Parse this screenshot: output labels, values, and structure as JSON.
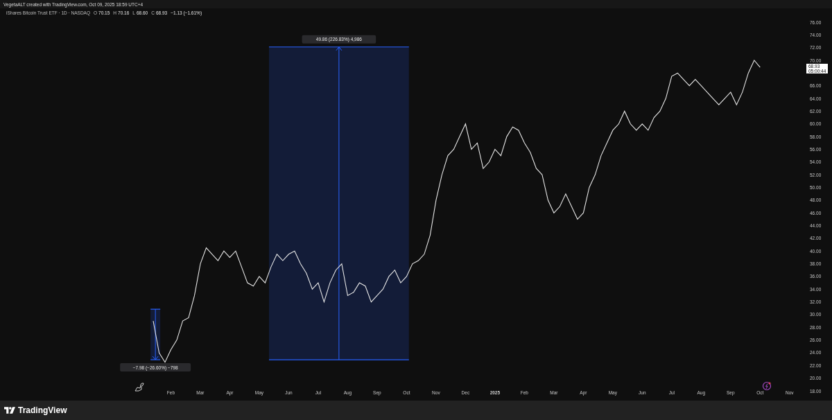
{
  "header": {
    "caption": "VegetaALT created with TradingView.com, Oct 09, 2025 18:59 UTC+4"
  },
  "legend": {
    "symbol": "iShares Bitcoin Trust ETF · 1D · NASDAQ",
    "ohlc": [
      {
        "label": "O",
        "value": "70.15"
      },
      {
        "label": "H",
        "value": "70.16"
      },
      {
        "label": "L",
        "value": "68.60"
      },
      {
        "label": "C",
        "value": "68.93"
      }
    ],
    "change": "−1.13 (−1.61%)"
  },
  "price_tag": {
    "value": "68.93",
    "countdown": "05:00:44"
  },
  "chart": {
    "chart_data": {
      "type": "line",
      "categories": [
        null,
        null,
        null,
        "Feb",
        null,
        null,
        null,
        null,
        "Mar",
        null,
        null,
        null,
        null,
        "Apr",
        null,
        null,
        null,
        null,
        "May",
        null,
        null,
        null,
        null,
        "Jun",
        null,
        null,
        null,
        null,
        "Jul",
        null,
        null,
        null,
        null,
        "Aug",
        null,
        null,
        null,
        null,
        "Sep",
        null,
        null,
        null,
        null,
        "Oct",
        null,
        null,
        null,
        null,
        "Nov",
        null,
        null,
        null,
        null,
        "Dec",
        null,
        null,
        null,
        null,
        "2025",
        null,
        null,
        null,
        null,
        "Feb",
        null,
        null,
        null,
        null,
        "Mar",
        null,
        null,
        null,
        null,
        "Apr",
        null,
        null,
        null,
        null,
        "May",
        null,
        null,
        null,
        null,
        "Jun",
        null,
        null,
        null,
        null,
        "Jul",
        null,
        null,
        null,
        null,
        "Aug",
        null,
        null,
        null,
        null,
        "Sep",
        null,
        null,
        null,
        null,
        "Oct",
        null,
        null,
        null,
        null,
        "Nov"
      ],
      "series": [
        {
          "color": "#e6e6e6",
          "values": [
            29,
            24,
            22.5,
            24.5,
            26,
            29,
            29.5,
            33,
            38,
            40.5,
            39.5,
            38.5,
            40,
            39,
            40,
            37.5,
            35,
            34.5,
            36,
            35,
            37.5,
            39.5,
            38.5,
            39.5,
            40,
            38,
            36.5,
            34,
            35,
            32,
            35,
            37,
            38,
            33,
            33.5,
            35,
            34.5,
            32,
            33,
            34,
            36,
            37,
            35,
            36,
            38,
            38.5,
            39.5,
            42.5,
            48,
            52,
            55,
            56,
            58,
            60,
            56,
            57,
            53,
            54,
            56,
            55,
            58,
            59.5,
            59,
            57,
            55.5,
            53,
            52,
            48,
            46,
            47,
            49,
            47,
            45,
            46,
            50,
            52,
            55,
            57,
            59,
            60,
            62,
            60,
            59,
            60,
            59,
            61,
            62,
            64,
            67.5,
            68,
            67,
            66,
            67,
            66,
            65,
            64,
            63,
            64,
            65,
            63,
            65,
            68,
            70,
            68.9,
            null,
            null,
            null,
            null,
            null
          ]
        }
      ],
      "ylim": [
        18,
        76
      ],
      "yticks": [
        {
          "value": 76,
          "label": "76.00"
        },
        {
          "value": 74,
          "label": "74.00"
        },
        {
          "value": 72,
          "label": "72.00"
        },
        {
          "value": 70,
          "label": "70.00"
        },
        {
          "value": 66,
          "label": "66.00"
        },
        {
          "value": 64,
          "label": "64.00"
        },
        {
          "value": 62,
          "label": "62.00"
        },
        {
          "value": 60,
          "label": "60.00"
        },
        {
          "value": 58,
          "label": "58.00"
        },
        {
          "value": 56,
          "label": "56.00"
        },
        {
          "value": 54,
          "label": "54.00"
        },
        {
          "value": 52,
          "label": "52.00"
        },
        {
          "value": 50,
          "label": "50.00"
        },
        {
          "value": 48,
          "label": "48.00"
        },
        {
          "value": 46,
          "label": "46.00"
        },
        {
          "value": 44,
          "label": "44.00"
        },
        {
          "value": 42,
          "label": "42.00"
        },
        {
          "value": 40,
          "label": "40.00"
        },
        {
          "value": 38,
          "label": "38.00"
        },
        {
          "value": 36,
          "label": "36.00"
        },
        {
          "value": 34,
          "label": "34.00"
        },
        {
          "value": 32,
          "label": "32.00"
        },
        {
          "value": 30,
          "label": "30.00"
        },
        {
          "value": 28,
          "label": "28.00"
        },
        {
          "value": 26,
          "label": "26.00"
        },
        {
          "value": 24,
          "label": "24.00"
        },
        {
          "value": 22,
          "label": "22.00"
        },
        {
          "value": 20,
          "label": "20.00"
        },
        {
          "value": 18,
          "label": "18.00"
        }
      ]
    },
    "measures": [
      {
        "text": "−7.98 (−26.60%) −798"
      },
      {
        "text": "49.86 (226.83%) 4,986"
      }
    ]
  },
  "footer": {
    "brand": "TradingView"
  }
}
